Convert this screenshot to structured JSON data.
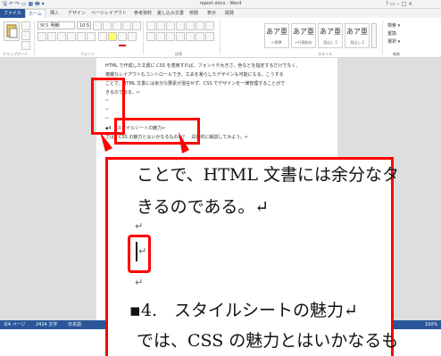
{
  "titlebar": {
    "quick_access": "🖫 ↶ ↷ ▭ ▦ 🖶 ▾",
    "title": "report.docx - Word",
    "controls": "?  ▭  –  □  ×"
  },
  "tabs": [
    "ファイル",
    "ホーム",
    "挿入",
    "デザイン",
    "ページレイアウト",
    "参考資料",
    "差し込み文書",
    "校閲",
    "表示",
    "開発"
  ],
  "ribbon": {
    "font_name": "ＭＳ 明朝",
    "font_size": "10.5",
    "groups": [
      "クリップボード",
      "フォント",
      "段落",
      "スタイル",
      "編集"
    ],
    "styles": [
      {
        "sample": "あア亜",
        "label": "↵標準"
      },
      {
        "sample": "あア亜",
        "label": "↵行間詰め"
      },
      {
        "sample": "あア亜",
        "label": "見出し 1"
      },
      {
        "sample": "あア亜",
        "label": "見出し 2"
      }
    ],
    "edit_items": [
      "検索 ▾",
      "置換",
      "選択 ▾"
    ]
  },
  "document": {
    "lines": [
      "HTML で作成した文書に CSS を適用すれば、フォントや大きさ、色などを指定するだけでなく、",
      "複雑なレイアウトもコントロールでき、工夫を凝らしたデザインも可能になる。こうする",
      "ことで、HTML 文書には余分な要素が混在せず、CSS でデザインを一律管理することがで",
      "きるのである。↵"
    ],
    "heading": "▪4.　スタイルシートの魅力↵",
    "body_line": "では、CSS の魅力とはいかなるものか？　具体的に解説してみよう。↵"
  },
  "status": {
    "page": "3/4 ページ",
    "words": "2424 文字",
    "lang": "日本語",
    "zoom": "100%"
  },
  "zoom_callout": {
    "line1": "ことで、HTML 文書には余分なタ",
    "line2": "きるのである。↵",
    "empty_mark": "↵",
    "cursor_mark": "↵",
    "after_mark": "↵",
    "heading": "▪4.　スタイルシートの魅力↵",
    "body": "では、CSS の魅力とはいかなるも"
  },
  "colors": {
    "accent": "#2b579a",
    "highlight": "#ff0000"
  }
}
